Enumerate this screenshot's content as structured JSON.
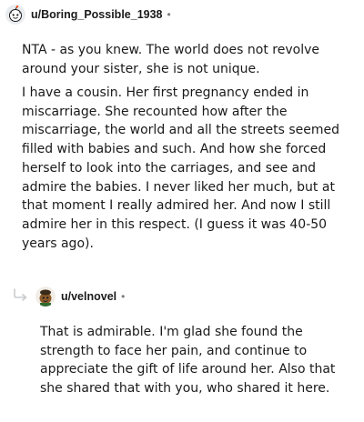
{
  "parent_comment": {
    "username": "u/Boring_Possible_1938",
    "separator": "•",
    "paragraphs": [
      {
        "lines": [
          "NTA - as you knew. The world does not revolve",
          "around your sister, she is not unique."
        ]
      },
      {
        "lines": [
          "I have a cousin. Her first pregnancy ended in",
          "miscarriage. She recounted how after the",
          "miscarriage, the world and all the streets seemed",
          "filled with babies and such. And how she forced",
          "herself to look into the carriages, and see and",
          "admire the babies. I never liked her much, but at",
          "that moment I really admired her. And now I still",
          "admire her in this respect. (I guess it was 40-50",
          "years ago)."
        ]
      }
    ]
  },
  "reply_comment": {
    "username": "u/velnovel",
    "separator": "•",
    "paragraphs": [
      {
        "lines": [
          "That is admirable. I'm glad she found the",
          "strength to face her pain, and continue to",
          "appreciate the gift of life around her. Also that",
          "she shared that with you, who shared it here."
        ]
      }
    ]
  },
  "icons": {
    "parent_avatar": "snoo-avatar-icon",
    "reply_avatar": "snoo-avatar-icon",
    "reply_indicator": "reply-arrow-icon"
  },
  "colors": {
    "text": "#1a1a1b",
    "meta": "#7c7c7c",
    "thread_line": "#c8cbcd"
  }
}
